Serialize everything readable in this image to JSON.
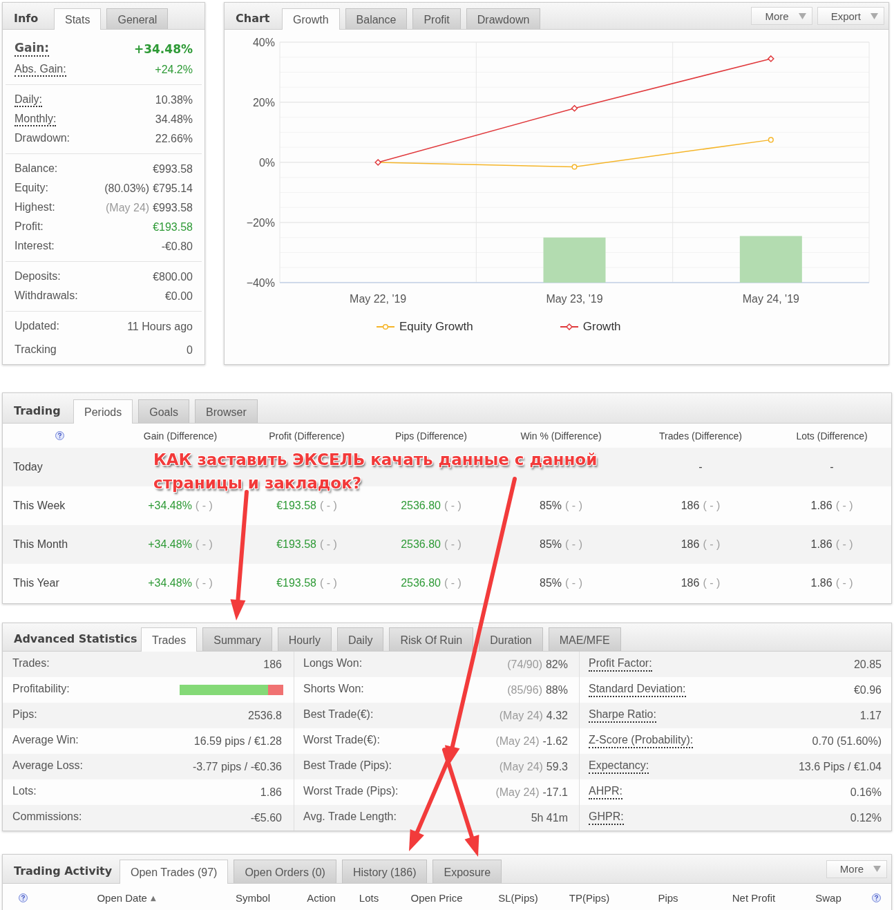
{
  "info": {
    "title": "Info",
    "tabs": [
      {
        "label": "Stats",
        "selected": true
      },
      {
        "label": "General",
        "selected": false
      }
    ],
    "groups": [
      {
        "rows": [
          {
            "kind": "main",
            "label": "Gain:",
            "value": "+34.48%",
            "underlined": true,
            "positive": true
          },
          {
            "kind": "normal",
            "label": "Abs. Gain:",
            "value": "+24.2%",
            "underlined": true,
            "positive": true
          }
        ]
      },
      {
        "rows": [
          {
            "label": "Daily:",
            "value": "10.38%",
            "underlined": true,
            "positive": false
          },
          {
            "label": "Monthly:",
            "value": "34.48%",
            "underlined": true,
            "positive": false
          },
          {
            "label": "Drawdown:",
            "value": "22.66%",
            "underlined": false,
            "positive": false
          }
        ]
      },
      {
        "rows": [
          {
            "label": "Balance:",
            "value": "€993.58",
            "underlined": false,
            "positive": false
          },
          {
            "label": "Equity:",
            "note": {
              "text": "(80.03%)",
              "muted": false
            },
            "value": "€795.14",
            "underlined": false,
            "positive": false
          },
          {
            "label": "Highest:",
            "note": {
              "text": "(May 24)",
              "muted": true
            },
            "value": "€993.58",
            "underlined": false,
            "positive": false
          },
          {
            "label": "Profit:",
            "value": "€193.58",
            "underlined": false,
            "positive": true
          },
          {
            "label": "Interest:",
            "value": "-€0.80",
            "underlined": false,
            "positive": false
          }
        ]
      },
      {
        "rows": [
          {
            "label": "Deposits:",
            "value": "€800.00",
            "underlined": false,
            "positive": false
          },
          {
            "label": "Withdrawals:",
            "value": "€0.00",
            "underlined": false,
            "positive": false
          }
        ]
      },
      {
        "rows": [
          {
            "label": "Updated:",
            "value": "11 Hours ago",
            "underlined": false,
            "positive": false
          },
          {
            "label": "Tracking",
            "value": "0",
            "underlined": false,
            "positive": false
          }
        ]
      }
    ]
  },
  "chart": {
    "title": "Chart",
    "tabs": [
      {
        "label": "Growth",
        "selected": true
      },
      {
        "label": "Balance",
        "selected": false
      },
      {
        "label": "Profit",
        "selected": false
      },
      {
        "label": "Drawdown",
        "selected": false
      }
    ],
    "buttons": [
      "More",
      "Export"
    ],
    "chart_data": {
      "type": "line",
      "grid": true,
      "categories": [
        "May 22, '19",
        "May 23, '19",
        "May 24, '19"
      ],
      "ylim": [
        -40,
        40
      ],
      "yticks": [
        {
          "value": 40,
          "label": "40%"
        },
        {
          "value": 20,
          "label": "20%"
        },
        {
          "value": 0,
          "label": "0%"
        },
        {
          "value": -20,
          "label": "−20%"
        },
        {
          "value": -40,
          "label": "−40%"
        }
      ],
      "series": [
        {
          "marker": "circle",
          "name": "Equity Growth",
          "color": "#f5b529",
          "values": [
            0,
            -1.5,
            7.5
          ]
        },
        {
          "marker": "diamond",
          "name": "Growth",
          "color": "#e0393c",
          "values": [
            0,
            18,
            34.5
          ]
        }
      ]
    }
  },
  "trading": {
    "title": "Trading",
    "tabs": [
      {
        "label": "Periods",
        "selected": true
      },
      {
        "label": "Goals",
        "selected": false
      },
      {
        "label": "Browser",
        "selected": false
      }
    ],
    "columns": [
      "Gain (Difference)",
      "Profit (Difference)",
      "Pips (Difference)",
      "Win % (Difference)",
      "Trades (Difference)",
      "Lots (Difference)"
    ],
    "rows": [
      {
        "period": "Today",
        "cells": {
          "trades": {
            "value": "-",
            "positive": false
          },
          "lots": {
            "value": "-",
            "positive": false
          }
        }
      },
      {
        "period": "This Week",
        "cells": {
          "gain": {
            "value": "+34.48%",
            "diff": "( - )",
            "positive": true
          },
          "profit": {
            "value": "€193.58",
            "diff": "( - )",
            "positive": true
          },
          "pips": {
            "value": "2536.80",
            "diff": "( - )",
            "positive": true
          },
          "win": {
            "value": "85%",
            "diff": "( - )",
            "positive": false
          },
          "trades": {
            "value": "186",
            "diff": "( - )",
            "positive": false
          },
          "lots": {
            "value": "1.86",
            "diff": "( - )",
            "positive": false
          }
        }
      },
      {
        "period": "This Month",
        "cells": {
          "gain": {
            "value": "+34.48%",
            "diff": "( - )",
            "positive": true
          },
          "profit": {
            "value": "€193.58",
            "diff": "( - )",
            "positive": true
          },
          "pips": {
            "value": "2536.80",
            "diff": "( - )",
            "positive": true
          },
          "win": {
            "value": "85%",
            "diff": "( - )",
            "positive": false
          },
          "trades": {
            "value": "186",
            "diff": "( - )",
            "positive": false
          },
          "lots": {
            "value": "1.86",
            "diff": "( - )",
            "positive": false
          }
        }
      },
      {
        "period": "This Year",
        "cells": {
          "gain": {
            "value": "+34.48%",
            "diff": "( - )",
            "positive": true
          },
          "profit": {
            "value": "€193.58",
            "diff": "( - )",
            "positive": true
          },
          "pips": {
            "value": "2536.80",
            "diff": "( - )",
            "positive": true
          },
          "win": {
            "value": "85%",
            "diff": "( - )",
            "positive": false
          },
          "trades": {
            "value": "186",
            "diff": "( - )",
            "positive": false
          },
          "lots": {
            "value": "1.86",
            "diff": "( - )",
            "positive": false
          }
        }
      }
    ]
  },
  "advanced": {
    "title": "Advanced Statistics",
    "tabs": [
      {
        "label": "Trades",
        "selected": true
      },
      {
        "label": "Summary",
        "selected": false
      },
      {
        "label": "Hourly",
        "selected": false
      },
      {
        "label": "Daily",
        "selected": false
      },
      {
        "label": "Risk Of Ruin",
        "selected": false
      },
      {
        "label": "Duration",
        "selected": false
      },
      {
        "label": "MAE/MFE",
        "selected": false
      }
    ],
    "columns": [
      {
        "rows": [
          {
            "kind": "text",
            "label": "Trades:",
            "value": "186",
            "underlined": false
          },
          {
            "kind": "bar",
            "label": "Profitability:",
            "level": 0.853,
            "underlined": false
          },
          {
            "kind": "text",
            "label": "Pips:",
            "value": "2536.8",
            "underlined": false
          },
          {
            "kind": "text",
            "label": "Average Win:",
            "value": "16.59 pips / €1.28",
            "underlined": false
          },
          {
            "kind": "text",
            "label": "Average Loss:",
            "value": "-3.77 pips / -€0.36",
            "underlined": false
          },
          {
            "kind": "text",
            "label": "Lots:",
            "value": "1.86",
            "underlined": false
          },
          {
            "kind": "text",
            "label": "Commissions:",
            "value": "-€5.60",
            "underlined": false
          }
        ]
      },
      {
        "rows": [
          {
            "label": "Longs Won:",
            "note": {
              "text": "(74/90)",
              "muted": true
            },
            "value": "82%",
            "underlined": false
          },
          {
            "label": "Shorts Won:",
            "note": {
              "text": "(85/96)",
              "muted": true
            },
            "value": "88%",
            "underlined": false
          },
          {
            "label": "Best Trade(€):",
            "note": {
              "text": "(May 24)",
              "muted": true
            },
            "value": "4.32",
            "underlined": false
          },
          {
            "label": "Worst Trade(€):",
            "note": {
              "text": "(May 24)",
              "muted": true
            },
            "value": "-1.62",
            "underlined": false
          },
          {
            "label": "Best Trade (Pips):",
            "note": {
              "text": "(May 24)",
              "muted": true
            },
            "value": "59.3",
            "underlined": false
          },
          {
            "label": "Worst Trade (Pips):",
            "note": {
              "text": "(May 24)",
              "muted": true
            },
            "value": "-17.1",
            "underlined": false
          },
          {
            "label": "Avg. Trade Length:",
            "value": "5h 41m",
            "underlined": false
          }
        ]
      },
      {
        "rows": [
          {
            "label": "Profit Factor:",
            "value": "20.85",
            "underlined": true
          },
          {
            "label": "Standard Deviation:",
            "value": "€0.96",
            "underlined": true
          },
          {
            "label": "Sharpe Ratio:",
            "value": "1.17",
            "underlined": true
          },
          {
            "label": "Z-Score (Probability):",
            "value": "0.70 (51.60%)",
            "underlined": true
          },
          {
            "label": "Expectancy:",
            "value": "13.6 Pips / €1.04",
            "underlined": true
          },
          {
            "label": "AHPR:",
            "value": "0.16%",
            "underlined": true
          },
          {
            "label": "GHPR:",
            "value": "0.12%",
            "underlined": true
          }
        ]
      }
    ]
  },
  "activity": {
    "title": "Trading Activity",
    "tabs": [
      {
        "label": "Open Trades (97)",
        "selected": true
      },
      {
        "label": "Open Orders (0)",
        "selected": false
      },
      {
        "label": "History (186)",
        "selected": false
      },
      {
        "label": "Exposure",
        "selected": false
      }
    ],
    "button": "More",
    "columns": [
      {
        "label": "Open Date",
        "sort": "▲"
      },
      {
        "label": "Symbol"
      },
      {
        "label": "Action"
      },
      {
        "label": "Lots"
      },
      {
        "label": "Open Price"
      },
      {
        "label": "SL(Pips)"
      },
      {
        "label": "TP(Pips)"
      },
      {
        "label": "Pips"
      },
      {
        "label": "Net Profit"
      },
      {
        "label": "Swap"
      }
    ]
  },
  "annotation": {
    "text": "КАК заставить ЭКСЕЛЬ качать данные с данной страницы и закладок?"
  }
}
